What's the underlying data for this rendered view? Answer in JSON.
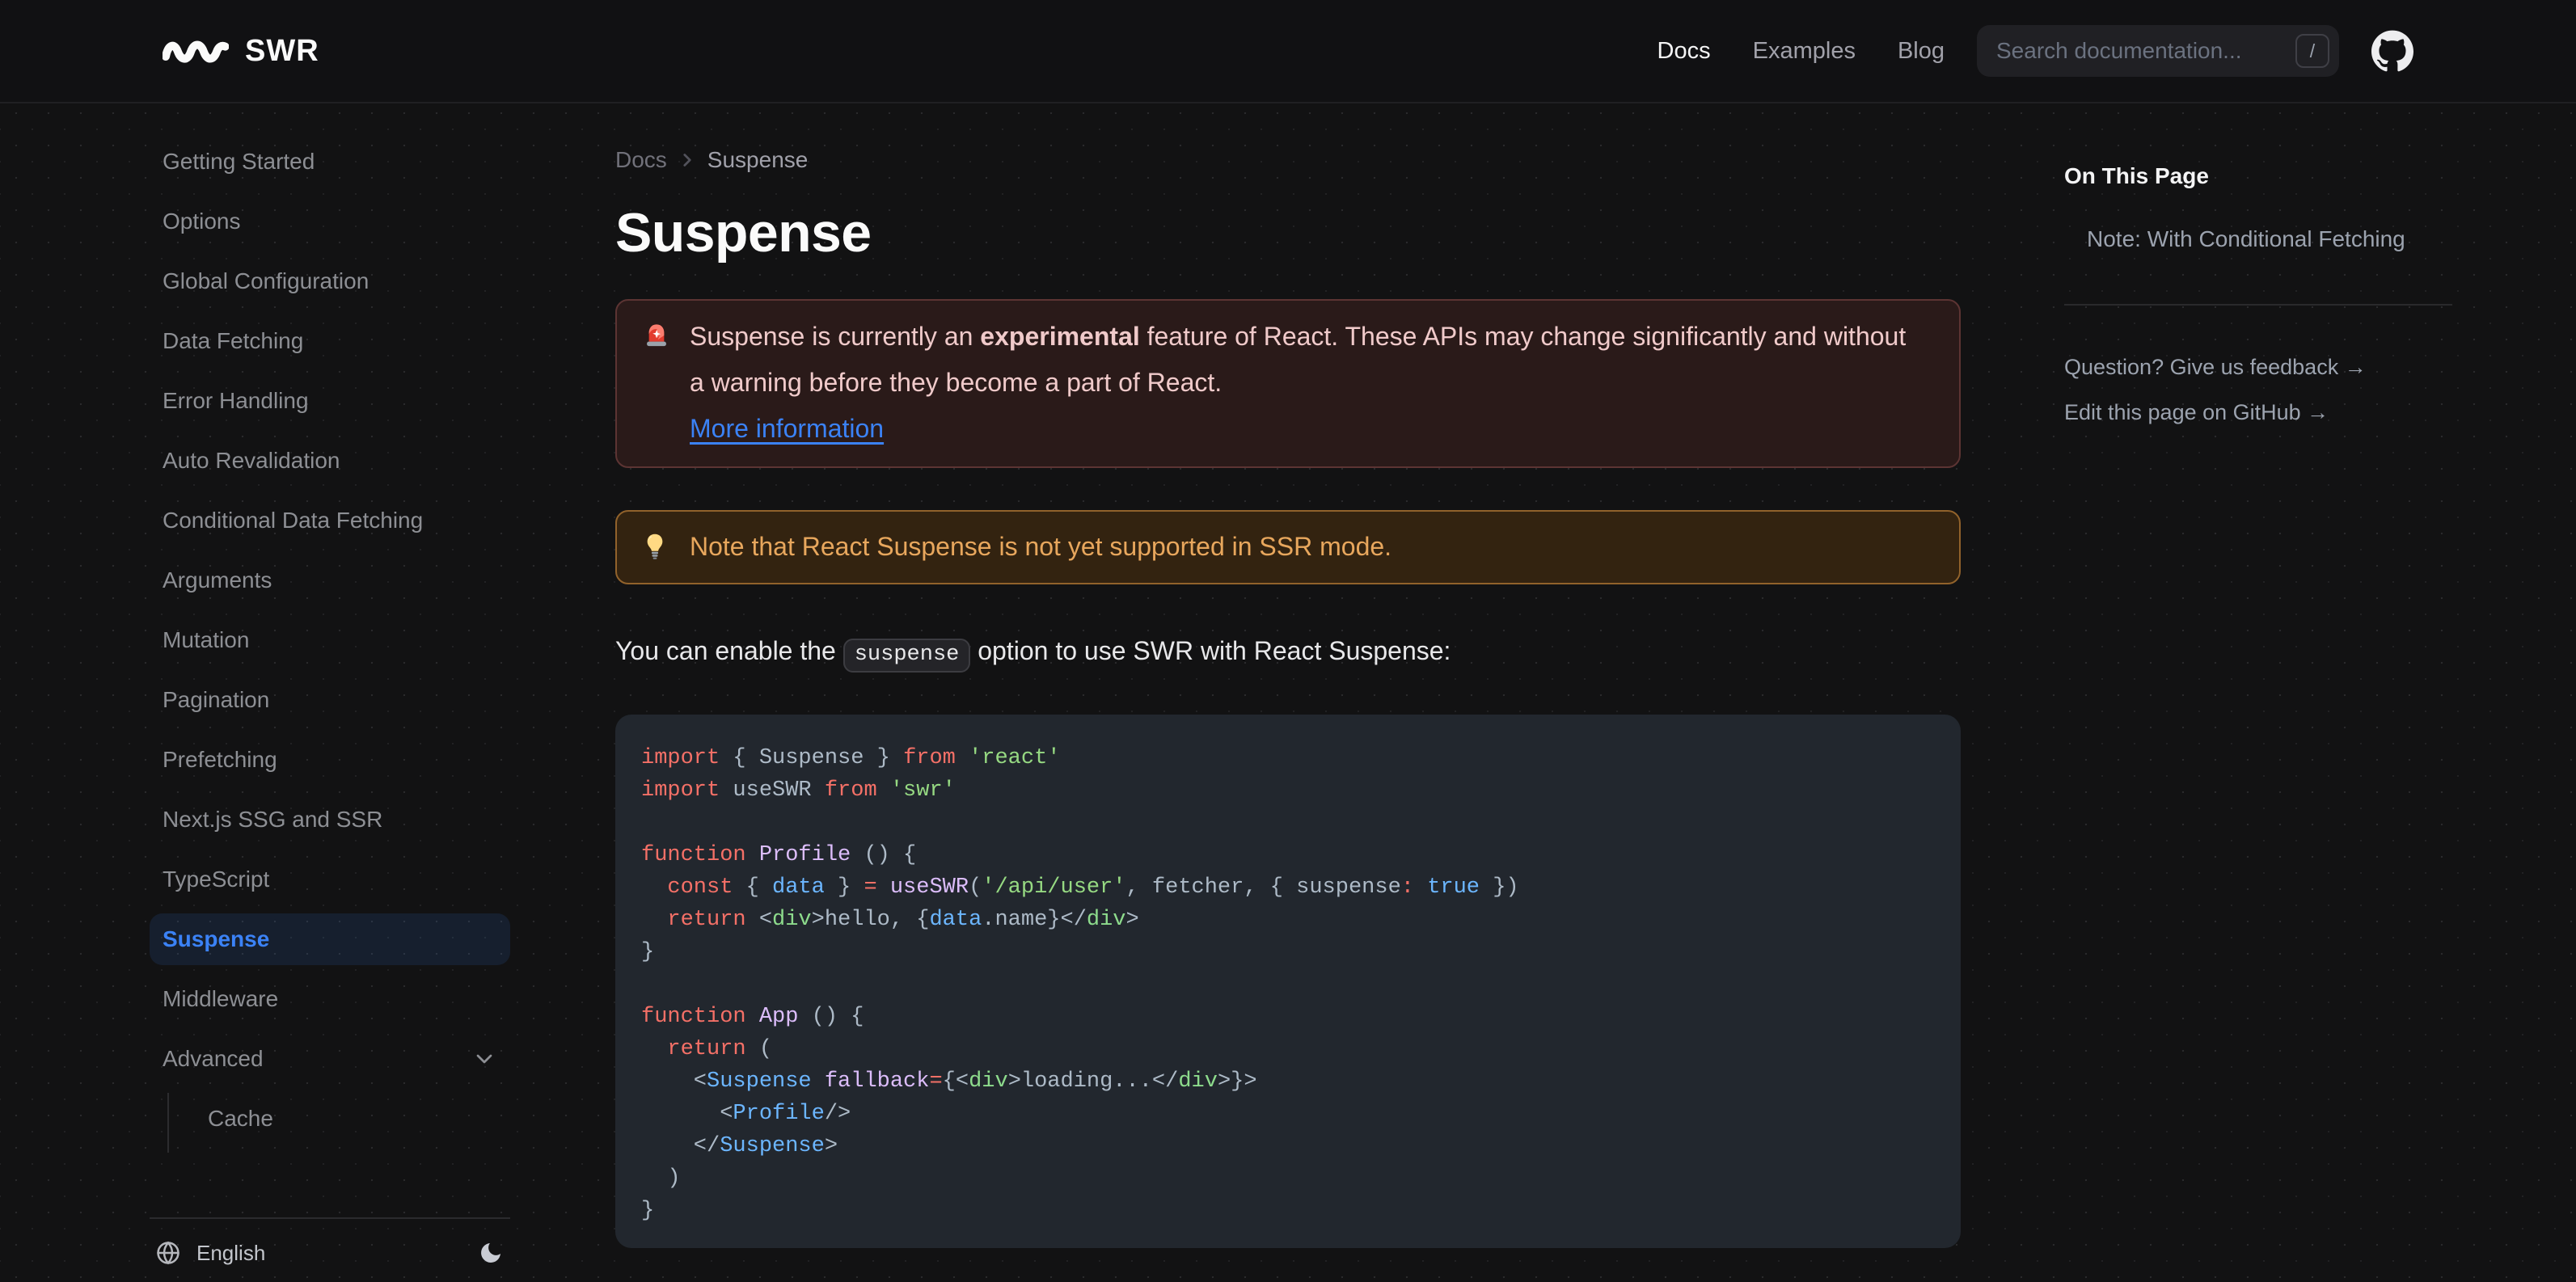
{
  "navbar": {
    "logo_text": "SWR",
    "links": [
      {
        "label": "Docs",
        "active": true
      },
      {
        "label": "Examples",
        "active": false
      },
      {
        "label": "Blog",
        "active": false
      }
    ],
    "search": {
      "placeholder": "Search documentation...",
      "shortcut": "/"
    },
    "icons": {
      "logo": "swr-squiggle",
      "repo": "github-mark"
    }
  },
  "sidebar": {
    "items": [
      "Getting Started",
      "Options",
      "Global Configuration",
      "Data Fetching",
      "Error Handling",
      "Auto Revalidation",
      "Conditional Data Fetching",
      "Arguments",
      "Mutation",
      "Pagination",
      "Prefetching",
      "Next.js SSG and SSR",
      "TypeScript",
      "Suspense",
      "Middleware"
    ],
    "active_item": "Suspense",
    "collapsible": {
      "label": "Advanced",
      "expanded": true,
      "children": [
        "Cache"
      ]
    },
    "footer": {
      "language": "English",
      "icons": {
        "language": "globe",
        "theme": "moon"
      }
    }
  },
  "breadcrumb": {
    "parent": "Docs",
    "current": "Suspense"
  },
  "page": {
    "title": "Suspense",
    "error_callout": {
      "icon": "siren-emoji",
      "text_before": "Suspense is currently an ",
      "text_bold": "experimental",
      "text_after": " feature of React. These APIs may change significantly and without a warning before they become a part of React.",
      "link_label": "More information"
    },
    "warning_callout": {
      "icon": "lightbulb-emoji",
      "text": "Note that React Suspense is not yet supported in SSR mode."
    },
    "intro": {
      "before": "You can enable the ",
      "code": "suspense",
      "after": " option to use SWR with React Suspense:"
    }
  },
  "code": {
    "language": "jsx",
    "lines": [
      [
        [
          "k",
          "import"
        ],
        [
          "p",
          " { Suspense } "
        ],
        [
          "k",
          "from"
        ],
        [
          "p",
          " "
        ],
        [
          "s",
          "'react'"
        ]
      ],
      [
        [
          "k",
          "import"
        ],
        [
          "p",
          " useSWR "
        ],
        [
          "k",
          "from"
        ],
        [
          "p",
          " "
        ],
        [
          "s",
          "'swr'"
        ]
      ],
      [],
      [
        [
          "k",
          "function"
        ],
        [
          "p",
          " "
        ],
        [
          "f",
          "Profile"
        ],
        [
          "p",
          " () {"
        ]
      ],
      [
        [
          "p",
          "  "
        ],
        [
          "k",
          "const"
        ],
        [
          "p",
          " { "
        ],
        [
          "c",
          "data"
        ],
        [
          "p",
          " } "
        ],
        [
          "k",
          "="
        ],
        [
          "p",
          " "
        ],
        [
          "f",
          "useSWR"
        ],
        [
          "p",
          "("
        ],
        [
          "s",
          "'/api/user'"
        ],
        [
          "p",
          ", fetcher, { suspense"
        ],
        [
          "k",
          ":"
        ],
        [
          "p",
          " "
        ],
        [
          "c",
          "true"
        ],
        [
          "p",
          " })"
        ]
      ],
      [
        [
          "p",
          "  "
        ],
        [
          "k",
          "return"
        ],
        [
          "p",
          " <"
        ],
        [
          "t",
          "div"
        ],
        [
          "p",
          ">hello, {"
        ],
        [
          "c",
          "data"
        ],
        [
          "p",
          ".name}</"
        ],
        [
          "t",
          "div"
        ],
        [
          "p",
          ">"
        ]
      ],
      [
        [
          "p",
          "}"
        ]
      ],
      [],
      [
        [
          "k",
          "function"
        ],
        [
          "p",
          " "
        ],
        [
          "f",
          "App"
        ],
        [
          "p",
          " () {"
        ]
      ],
      [
        [
          "p",
          "  "
        ],
        [
          "k",
          "return"
        ],
        [
          "p",
          " ("
        ]
      ],
      [
        [
          "p",
          "    <"
        ],
        [
          "c",
          "Suspense"
        ],
        [
          "p",
          " "
        ],
        [
          "f",
          "fallback"
        ],
        [
          "k",
          "="
        ],
        [
          "p",
          "{<"
        ],
        [
          "t",
          "div"
        ],
        [
          "p",
          ">loading...</"
        ],
        [
          "t",
          "div"
        ],
        [
          "p",
          ">}>"
        ]
      ],
      [
        [
          "p",
          "      <"
        ],
        [
          "c",
          "Profile"
        ],
        [
          "p",
          "/>"
        ]
      ],
      [
        [
          "p",
          "    </"
        ],
        [
          "c",
          "Suspense"
        ],
        [
          "p",
          ">"
        ]
      ],
      [
        [
          "p",
          "  )"
        ]
      ],
      [
        [
          "p",
          "}"
        ]
      ]
    ]
  },
  "toc": {
    "heading": "On This Page",
    "items": [
      "Note: With Conditional Fetching"
    ],
    "links": [
      "Question? Give us feedback →",
      "Edit this page on GitHub →"
    ]
  },
  "colors": {
    "accent": "#3b82f6",
    "body_background": "#121213",
    "code_background": "#22272e",
    "error_callout_bg": "#2a1a19",
    "error_callout_border": "#5c3433",
    "error_callout_text": "#f0caca",
    "warning_callout_bg": "#332310",
    "warning_callout_border": "#91622b",
    "warning_callout_text": "#e8a75d",
    "token_keyword": "#f47067",
    "token_string": "#96d982",
    "token_function": "#dcbdfb",
    "token_constant": "#6cb6ff",
    "token_tag": "#8ddb8c"
  }
}
